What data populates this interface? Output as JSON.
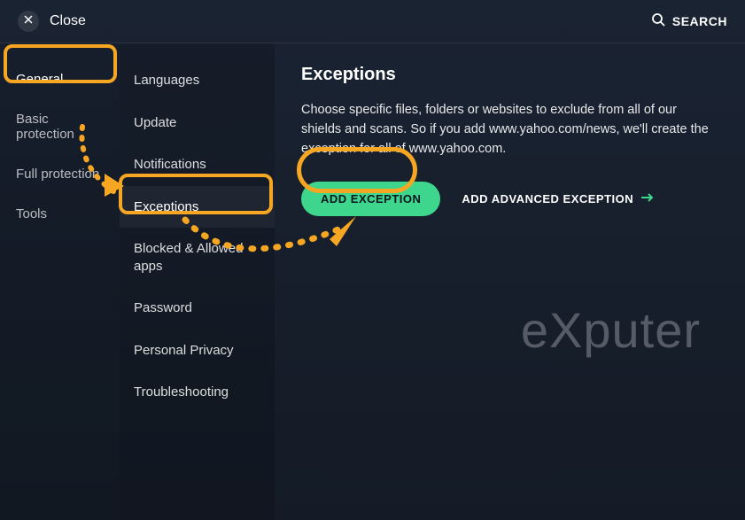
{
  "header": {
    "close_label": "Close",
    "search_label": "SEARCH"
  },
  "sidebar_primary": {
    "items": [
      {
        "label": "General"
      },
      {
        "label": "Basic protection"
      },
      {
        "label": "Full protection"
      },
      {
        "label": "Tools"
      }
    ]
  },
  "sidebar_secondary": {
    "items": [
      {
        "label": "Languages"
      },
      {
        "label": "Update"
      },
      {
        "label": "Notifications"
      },
      {
        "label": "Exceptions"
      },
      {
        "label": "Blocked & Allowed apps"
      },
      {
        "label": "Password"
      },
      {
        "label": "Personal Privacy"
      },
      {
        "label": "Troubleshooting"
      }
    ]
  },
  "content": {
    "title": "Exceptions",
    "description": "Choose specific files, folders or websites to exclude from all of our shields and scans. So if you add www.yahoo.com/news, we'll create the exception for all of www.yahoo.com.",
    "add_exception_label": "ADD EXCEPTION",
    "add_advanced_label": "ADD ADVANCED EXCEPTION"
  },
  "watermark": "eXputer",
  "colors": {
    "accent_green": "#3dd68c",
    "highlight_orange": "#f5a623"
  }
}
